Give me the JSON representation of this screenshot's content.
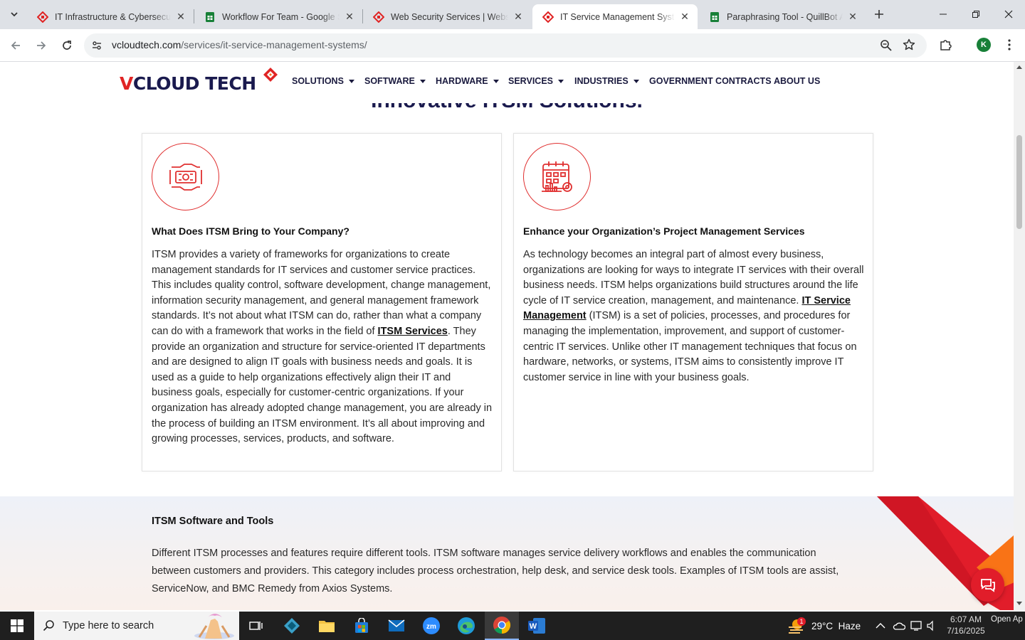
{
  "browser": {
    "tabs": [
      {
        "title": "IT Infrastructure & Cybersecurit",
        "favicon": "vcloud-favicon",
        "active": false
      },
      {
        "title": "Workflow For Team - Google Sh",
        "favicon": "google-sheets-favicon",
        "active": false
      },
      {
        "title": "Web Security Services | Website",
        "favicon": "vcloud-favicon",
        "active": false
      },
      {
        "title": "IT Service Management System",
        "favicon": "vcloud-favicon",
        "active": true
      },
      {
        "title": "Paraphrasing Tool - QuillBot AI",
        "favicon": "google-sheets-favicon",
        "active": false
      }
    ],
    "url_domain": "vcloudtech.com",
    "url_path": "/services/it-service-management-systems/",
    "profile_initial": "K"
  },
  "site": {
    "logo_part1": "V",
    "logo_part2": "CLOUD TECH",
    "nav": [
      {
        "label": "SOLUTIONS",
        "has_caret": true
      },
      {
        "label": "SOFTWARE",
        "has_caret": true
      },
      {
        "label": "HARDWARE",
        "has_caret": true
      },
      {
        "label": "SERVICES",
        "has_caret": true
      },
      {
        "label": "INDUSTRIES",
        "has_caret": true
      },
      {
        "label": "GOVERNMENT CONTRACTS",
        "has_caret": false
      },
      {
        "label": "ABOUT US",
        "has_caret": false
      }
    ],
    "partial_heading": "Innovative ITSM Solutions."
  },
  "cards": [
    {
      "icon": "handshake-gear-icon",
      "title": "What Does ITSM Bring to Your Company?",
      "body_before": "ITSM provides a variety of frameworks for organizations to create management standards for IT services and customer service practices. This includes quality control, software development, change management, information security management, and general management framework standards. It’s not about what ITSM can do, rather than what a company can do with a framework that works in the field of ",
      "link": "ITSM Services",
      "body_after": ". They provide an organization and structure for service-oriented IT departments and are designed to align IT goals with business needs and goals. It is used as a guide to help organizations effectively align their IT and business goals, especially for customer-centric organizations. If your organization has already adopted change management, you are already in the process of building an ITSM environment. It’s all about improving and growing processes, services, products, and software."
    },
    {
      "icon": "calendar-gear-icon",
      "title": "Enhance your Organization’s Project Management Services",
      "body_before": "As technology becomes an integral part of almost every business, organizations are looking for ways to integrate IT services with their overall business needs. ITSM helps organizations build structures around the life cycle of IT service creation, management, and maintenance. ",
      "link": "IT Service Management",
      "body_after": " (ITSM) is a set of policies, processes, and procedures for managing the implementation, improvement, and support of customer-centric IT services. Unlike other IT management techniques that focus on hardware, networks, or systems, ITSM aims to consistently improve IT customer service in line with your business goals."
    }
  ],
  "tools_section": {
    "title": "ITSM Software and Tools",
    "body": "Different ITSM processes and features require different tools. ITSM software manages service delivery workflows and enables the communication between customers and providers. This category includes process orchestration, help desk, and service desk tools. Examples of ITSM tools are assist, ServiceNow, and BMC Remedy from Axios Systems."
  },
  "taskbar": {
    "search_placeholder": "Type here to search",
    "weather": "29°C  Haze",
    "weather_badge": "1",
    "time": "6:07 AM",
    "date": "7/16/2025",
    "notification": "Open Ap"
  },
  "colors": {
    "accent_red": "#e02424",
    "navy": "#1a1a4e"
  }
}
